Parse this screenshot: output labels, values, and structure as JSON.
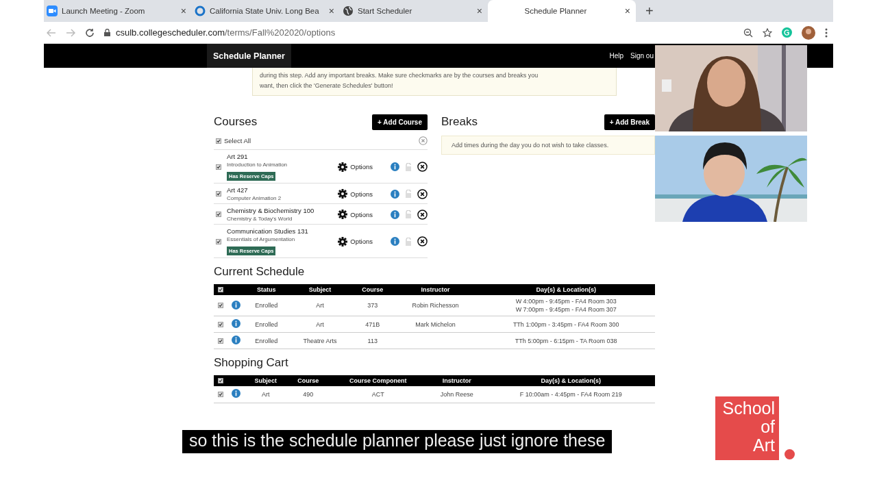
{
  "browser": {
    "tabs": [
      {
        "title": "Launch Meeting - Zoom",
        "close": "×",
        "selected": false
      },
      {
        "title": "California State Univ. Long Bea",
        "close": "×",
        "selected": false
      },
      {
        "title": "Start Scheduler",
        "close": "×",
        "selected": false
      },
      {
        "title": "Schedule Planner",
        "close": "×",
        "selected": true
      }
    ],
    "new_tab": "+",
    "url_host": "csulb.collegescheduler.com",
    "url_path": "/terms/Fall%202020/options"
  },
  "header": {
    "title": "Schedule Planner",
    "help": "Help",
    "sign_out": "Sign ou"
  },
  "notice": {
    "lines": [
      "during this step. Add any important breaks. Make sure checkmarks are by the courses and breaks you",
      "want, then click the 'Generate Schedules' button!"
    ]
  },
  "courses": {
    "heading": "Courses",
    "add_button": "+ Add Course",
    "select_all": {
      "label": "Select All",
      "checked": true
    },
    "items": [
      {
        "title": "Art 291",
        "subtitle": "Introduction to Animation",
        "badge": "Has Reserve Caps",
        "checked": true,
        "options": "Options"
      },
      {
        "title": "Art 427",
        "subtitle": "Computer Animation 2",
        "checked": true,
        "options": "Options"
      },
      {
        "title": "Chemistry & Biochemistry 100",
        "subtitle": "Chemistry & Today's World",
        "checked": true,
        "options": "Options"
      },
      {
        "title": "Communication Studies 131",
        "subtitle": "Essentials of Argumentation",
        "badge": "Has Reserve Caps",
        "checked": true,
        "options": "Options"
      }
    ]
  },
  "breaks": {
    "heading": "Breaks",
    "add_button": "+ Add Break",
    "empty_text": "Add times during the day you do not wish to take classes."
  },
  "current_schedule": {
    "heading": "Current Schedule",
    "header_checked": true,
    "columns": [
      "Status",
      "Subject",
      "Course",
      "Instructor",
      "Day(s) & Location(s)"
    ],
    "rows": [
      {
        "checked": true,
        "cells": [
          "Enrolled",
          "Art",
          "373",
          "Robin Richesson"
        ],
        "days": [
          "W 4:00pm - 9:45pm - FA4 Room 303",
          "W 7:00pm - 9:45pm - FA4 Room 307"
        ]
      },
      {
        "checked": true,
        "cells": [
          "Enrolled",
          "Art",
          "471B",
          "Mark Michelon"
        ],
        "days": [
          "TTh 1:00pm - 3:45pm - FA4 Room 300"
        ]
      },
      {
        "checked": true,
        "cells": [
          "Enrolled",
          "Theatre Arts",
          "113",
          ""
        ],
        "days": [
          "TTh 5:00pm - 6:15pm - TA Room 038"
        ]
      }
    ]
  },
  "shopping_cart": {
    "heading": "Shopping Cart",
    "header_checked": true,
    "columns": [
      "Subject",
      "Course",
      "Course Component",
      "Instructor",
      "Day(s) & Location(s)"
    ],
    "rows": [
      {
        "checked": true,
        "cells": [
          "Art",
          "490",
          "ACT",
          "John Reese"
        ],
        "days": [
          "F 10:00am - 4:45pm - FA4 Room 219"
        ]
      }
    ]
  },
  "caption": "so this is the schedule planner  please just ignore these",
  "logo": {
    "lines": [
      "School",
      "of",
      "Art"
    ]
  }
}
